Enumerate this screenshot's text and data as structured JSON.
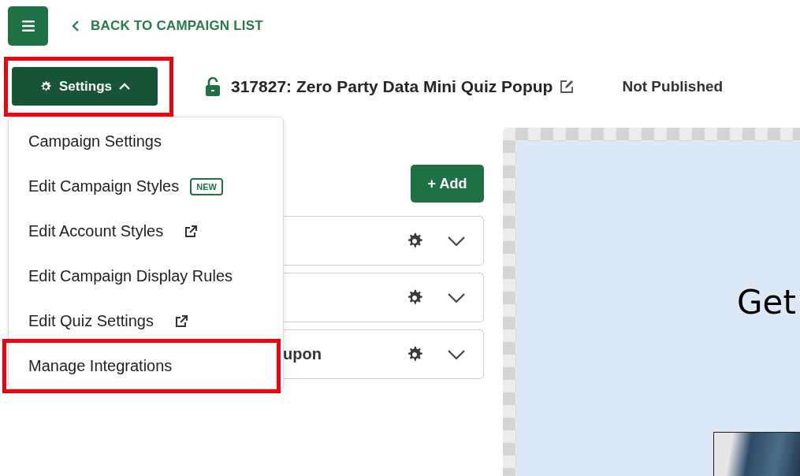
{
  "header": {
    "back_link": "BACK TO CAMPAIGN LIST"
  },
  "toolbar": {
    "settings_button": {
      "label": "Settings",
      "expanded": true,
      "highlighted": true
    },
    "locked": false,
    "campaign_title": "317827: Zero Party Data Mini Quiz Popup",
    "status": "Not Published"
  },
  "settings_menu": {
    "items": [
      {
        "label": "Campaign Settings",
        "kind": "plain",
        "highlighted": false
      },
      {
        "label": "Edit Campaign Styles",
        "kind": "badge",
        "badge": "NEW",
        "highlighted": false
      },
      {
        "label": "Edit Account Styles",
        "kind": "external",
        "highlighted": false
      },
      {
        "label": "Edit Campaign Display Rules",
        "kind": "plain",
        "highlighted": false
      },
      {
        "label": "Edit Quiz Settings",
        "kind": "external",
        "highlighted": false
      },
      {
        "label": "Manage Integrations",
        "kind": "plain",
        "highlighted": true
      }
    ]
  },
  "steps": {
    "add_button": "+ Add",
    "items": [
      {
        "expanded": false
      },
      {
        "expanded": false
      },
      {
        "label": "upon",
        "expanded": false
      }
    ]
  },
  "preview": {
    "heading": "Get"
  }
}
